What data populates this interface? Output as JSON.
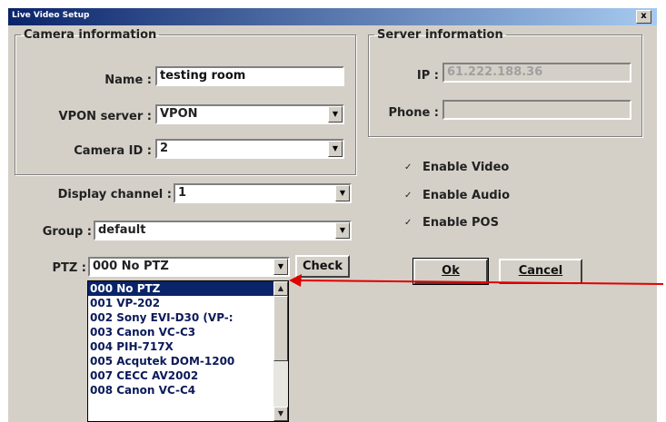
{
  "window": {
    "title": "Live Video Setup",
    "close_label": "x"
  },
  "camera_info": {
    "legend": "Camera information",
    "name_label": "Name :",
    "name_value": "testing room",
    "vpon_label": "VPON server :",
    "vpon_value": "VPON",
    "camera_id_label": "Camera ID :",
    "camera_id_value": "2"
  },
  "server_info": {
    "legend": "Server information",
    "ip_label": "IP :",
    "ip_value": "61.222.188.36",
    "phone_label": "Phone :",
    "phone_value": ""
  },
  "display_channel": {
    "label": "Display channel :",
    "value": "1"
  },
  "group": {
    "label": "Group :",
    "value": "default"
  },
  "ptz": {
    "label": "PTZ :",
    "value": "000 No PTZ",
    "check_label": "Check",
    "options": [
      "000 No PTZ",
      "001 VP-202",
      "002 Sony EVI-D30 (VP-:",
      "003 Canon VC-C3",
      "004 PIH-717X",
      "005 Acqutek DOM-1200",
      "007 CECC AV2002",
      "008 Canon VC-C4"
    ],
    "selected_index": 0
  },
  "checkboxes": [
    {
      "label": "Enable Video",
      "checked": true
    },
    {
      "label": "Enable Audio",
      "checked": true
    },
    {
      "label": "Enable POS",
      "checked": true
    }
  ],
  "buttons": {
    "ok_label": "Ok",
    "cancel_label": "Cancel"
  },
  "icons": {
    "checkbox_mark": "✓",
    "combo_arrow": "▼",
    "scroll_up": "▲",
    "scroll_down": "▼"
  },
  "colors": {
    "dialog_bg": "#d4d0c8",
    "title_start": "#0a246a",
    "title_end": "#a6caf0",
    "highlight": "#0a246a",
    "annotation_arrow": "#e00000"
  }
}
